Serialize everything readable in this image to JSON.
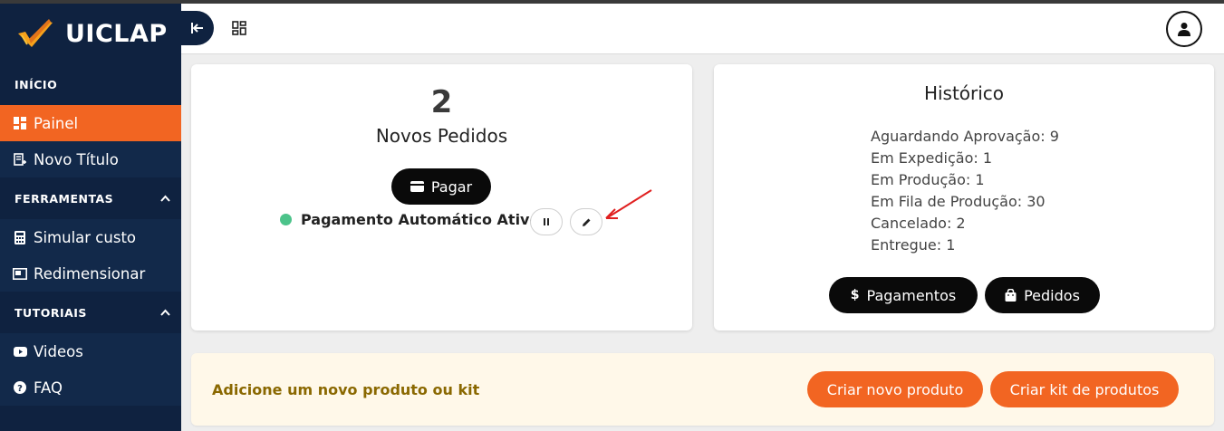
{
  "app": {
    "brand": "UICLAP"
  },
  "sidebar": {
    "sections": [
      {
        "title": "INÍCIO"
      },
      {
        "title": "FERRAMENTAS"
      },
      {
        "title": "TUTORIAIS"
      }
    ],
    "items": {
      "painel": "Painel",
      "novo_titulo": "Novo Título",
      "simular_custo": "Simular custo",
      "redimensionar": "Redimensionar",
      "videos": "Videos",
      "faq": "FAQ"
    }
  },
  "orders": {
    "count": "2",
    "title": "Novos Pedidos",
    "pay_label": "Pagar",
    "auto_payment_status": "Pagamento Automático Ativo"
  },
  "history": {
    "title": "Histórico",
    "entries": [
      "Aguardando Aprovação: 9",
      "Em Expedição: 1",
      "Em Produção: 1",
      "Em Fila de Produção: 30",
      "Cancelado: 2",
      "Entregue: 1"
    ],
    "payments_label": "Pagamentos",
    "orders_label": "Pedidos"
  },
  "banner": {
    "text": "Adicione um novo produto ou kit",
    "create_product_label": "Criar novo produto",
    "create_kit_label": "Criar kit de produtos"
  },
  "colors": {
    "sidebar_bg": "#0f2240",
    "accent": "#f26522",
    "active_status": "#4cc38a",
    "annotation_arrow": "#e02020"
  },
  "icons": [
    "logo-check-icon",
    "collapse-arrow-icon",
    "grid-icon",
    "user-icon",
    "dashboard-icon",
    "new-title-icon",
    "calculator-icon",
    "resize-icon",
    "youtube-icon",
    "help-icon",
    "card-icon",
    "pause-icon",
    "pencil-icon",
    "dollar-icon",
    "bag-icon",
    "chevron-up-icon"
  ]
}
